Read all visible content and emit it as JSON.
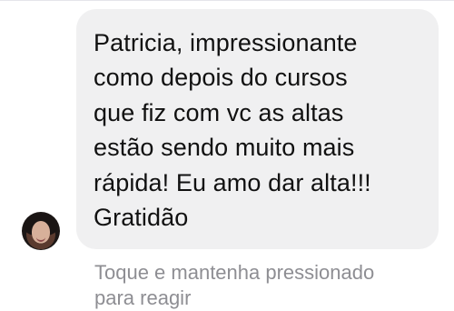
{
  "message": {
    "text": "Patricia, impressionante\ncomo depois do cursos\nque fiz com vc as altas\nestão sendo muito mais\nrápida! Eu amo dar alta!!!\nGratidão"
  },
  "hint": {
    "text": "Toque e mantenha pressionado\npara reagir"
  },
  "icons": {
    "avatar": "profile-avatar-icon"
  },
  "colors": {
    "bubble": "#f0f0f1",
    "message_text": "#111111",
    "hint_text": "#8e8e93",
    "background": "#ffffff"
  }
}
